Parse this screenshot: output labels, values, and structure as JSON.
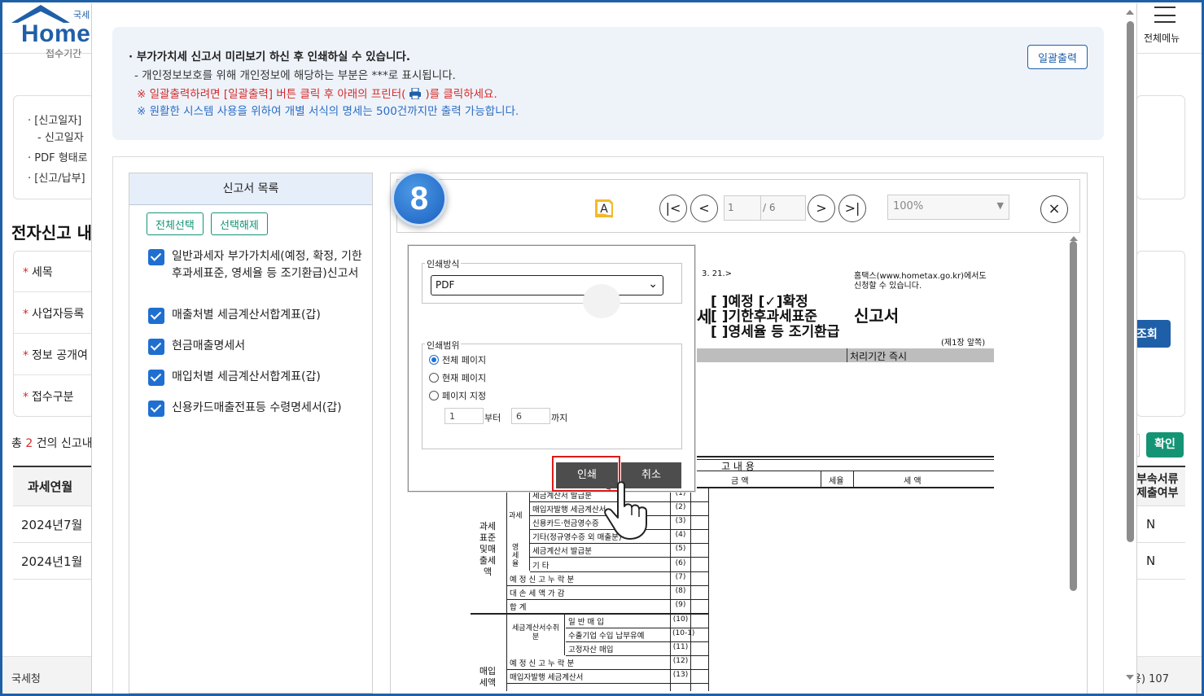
{
  "header": {
    "logo_main": "Home",
    "logo_small": "국세",
    "cut_text": "접수기간",
    "menu_label": "전체메뉴"
  },
  "background": {
    "notice_lines": [
      "· [신고일자]",
      "- 신고일자",
      "· PDF 형태로",
      "· [신고/납부]"
    ],
    "section_title": "전자신고 내",
    "fields": [
      "세목",
      "사업자등록",
      "정보 공개여",
      "접수구분"
    ],
    "search_btn": "조회",
    "count_prefix": "총",
    "count_num": "2",
    "count_suffix": "건의 신고내",
    "confirm_btn": "확인",
    "table_header": "과세연월",
    "table_header_r": "부속서류\n제출여부",
    "rows": [
      "2024년7월",
      "2024년1월"
    ],
    "rows_r": [
      "N",
      "N"
    ],
    "footer_left": "국세청",
    "footer_right": "용) 107"
  },
  "info": {
    "main": "부가가치세 신고서 미리보기 하신 후 인쇄하실 수 있습니다.",
    "sub": "- 개인정보보호를 위해 개인정보에 해당하는 부분은 ***로 표시됩니다.",
    "red_before": "※ 일괄출력하려면 [일괄출력] 버튼 클릭 후 아래의 프린터(",
    "red_after": ")를 클릭하세요.",
    "blue": "※ 원활한 시스템 사용을 위하여 개별 서식의 명세는 500건까지만 출력 가능합니다.",
    "bulk_btn": "일괄출력"
  },
  "list": {
    "title": "신고서 목록",
    "select_all": "전체선택",
    "deselect": "선택해제",
    "items": [
      "일반과세자 부가가치세(예정, 확정, 기한후과세표준, 영세율 등 조기환급)신고서",
      "매출처별 세금계산서합계표(갑)",
      "현금매출명세서",
      "매입처별 세금계산서합계표(갑)",
      "신용카드매출전표등 수령명세서(갑)"
    ]
  },
  "viewer": {
    "step": "8",
    "page_current": "1",
    "page_total": "/ 6",
    "zoom": "100%",
    "nav_first": "|<",
    "nav_prev": "<",
    "nav_next": ">",
    "nav_last": ">|",
    "close": "×"
  },
  "doc": {
    "date_frag": "3. 21.>",
    "hometax_note_1": "홈택스(www.hometax.go.kr)에서도",
    "hometax_note_2": "신청할 수 있습니다.",
    "opt1": "[ ]예정 [✓]확정",
    "opt2": "[ ]기한후과세표준",
    "opt3": "[ ]영세율 등 조기환급",
    "tax_char": "세",
    "title": "신고서",
    "page_note": "(제1장 앞쪽)",
    "process_period": "처리기간 즉시",
    "content_header": "고  내  용",
    "col_amount": "금        액",
    "col_rate": "세율",
    "col_tax": "세        액",
    "side_label_1": "과세표준및매출세액",
    "side_label_2": "매입세액",
    "sub_label_tax": "과세",
    "sub_label_zero": "영세율",
    "sub_label_invoice": "세금계산서수취분",
    "rows": [
      {
        "label": "세금계산서 발급분",
        "num": "(1)"
      },
      {
        "label": "매입자발행 세금계산서",
        "num": "(2)"
      },
      {
        "label": "신용카드·현금영수증",
        "num": "(3)"
      },
      {
        "label": "기타(정규영수증 외 매출분)",
        "num": "(4)"
      },
      {
        "label": "세금계산서 발급분",
        "num": "(5)"
      },
      {
        "label": "기 타",
        "num": "(6)"
      },
      {
        "label": "예 정 신 고  누 락 분",
        "num": "(7)"
      },
      {
        "label": "대 손 세 액  가 감",
        "num": "(8)"
      },
      {
        "label": "합 계",
        "num": "(9)"
      },
      {
        "label": "일 반 매 입",
        "num": "(10)"
      },
      {
        "label": "수출기업 수입 납부유예",
        "num": "(10-1)"
      },
      {
        "label": "고정자산 매입",
        "num": "(11)"
      },
      {
        "label": "예 정 신 고  누 락 분",
        "num": "(12)"
      },
      {
        "label": "매입자발행 세금계산서",
        "num": "(13)"
      }
    ]
  },
  "print_dialog": {
    "method_legend": "인쇄방식",
    "format_value": "PDF",
    "range_legend": "인쇄범위",
    "opt_all": "전체 페이지",
    "opt_current": "현재 페이지",
    "opt_custom": "페이지 지정",
    "from_value": "1",
    "from_label": "부터",
    "to_value": "6",
    "to_label": "까지",
    "print_btn": "인쇄",
    "cancel_btn": "취소"
  },
  "colors": {
    "brand": "#1f5fa8",
    "accent_green": "#149474",
    "red": "#d42b2b",
    "blue_text": "#2b6cc4",
    "highlight": "#e01919"
  }
}
